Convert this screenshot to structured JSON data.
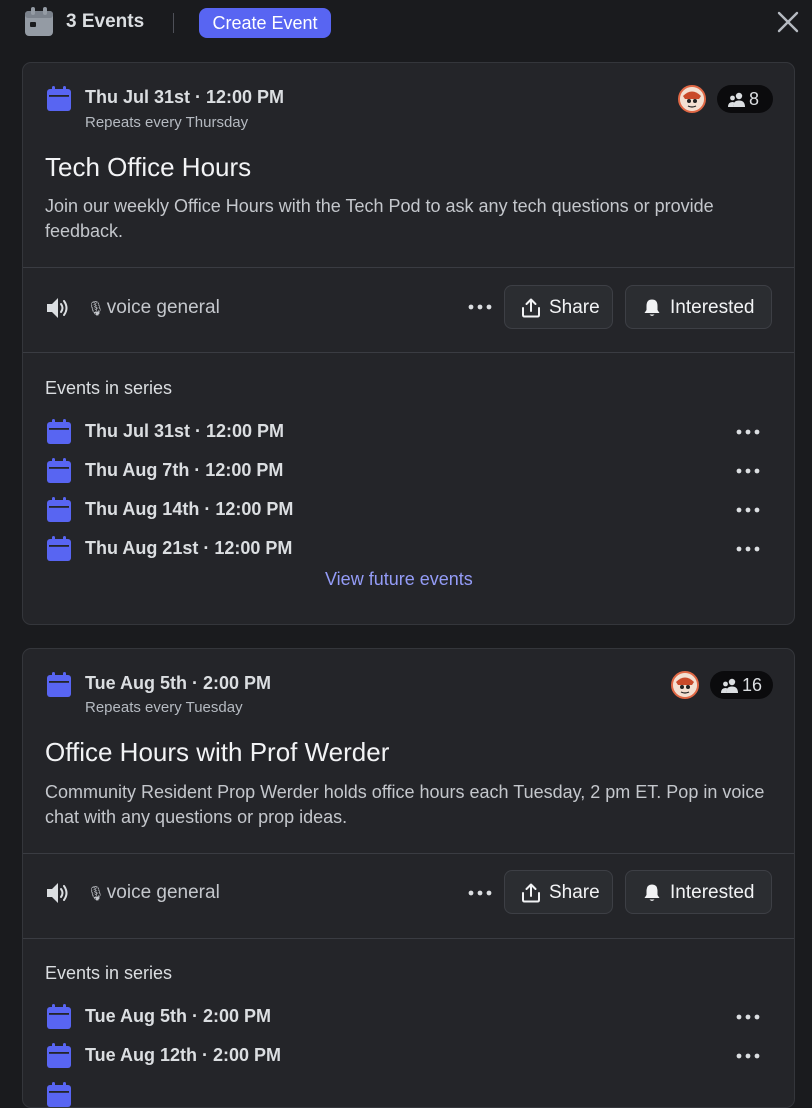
{
  "header": {
    "events_count": "3 Events",
    "create_label": "Create Event"
  },
  "colors": {
    "accent": "#5865f2",
    "link": "#949cf7",
    "background": "#1a1b1e",
    "card": "#242529"
  },
  "events": [
    {
      "date": "Thu Jul 31st · 12:00 PM",
      "repeats": "Repeats every Thursday",
      "interested_count": "8",
      "title": "Tech Office Hours",
      "description": "Join our weekly Office Hours with the Tech Pod to ask any tech questions or provide feedback.",
      "channel": "voice general",
      "share_label": "Share",
      "interested_label": "Interested",
      "series_heading": "Events in series",
      "series": [
        "Thu Jul 31st · 12:00 PM",
        "Thu Aug 7th · 12:00 PM",
        "Thu Aug 14th · 12:00 PM",
        "Thu Aug 21st · 12:00 PM"
      ],
      "view_future": "View future events"
    },
    {
      "date": "Tue Aug 5th · 2:00 PM",
      "repeats": "Repeats every Tuesday",
      "interested_count": "16",
      "title": "Office Hours with Prof Werder",
      "description": "Community Resident Prop Werder holds office hours each Tuesday, 2 pm ET. Pop in voice chat with any questions or prop ideas.",
      "channel": "voice general",
      "share_label": "Share",
      "interested_label": "Interested",
      "series_heading": "Events in series",
      "series": [
        "Tue Aug 5th · 2:00 PM",
        "Tue Aug 12th · 2:00 PM"
      ]
    }
  ]
}
